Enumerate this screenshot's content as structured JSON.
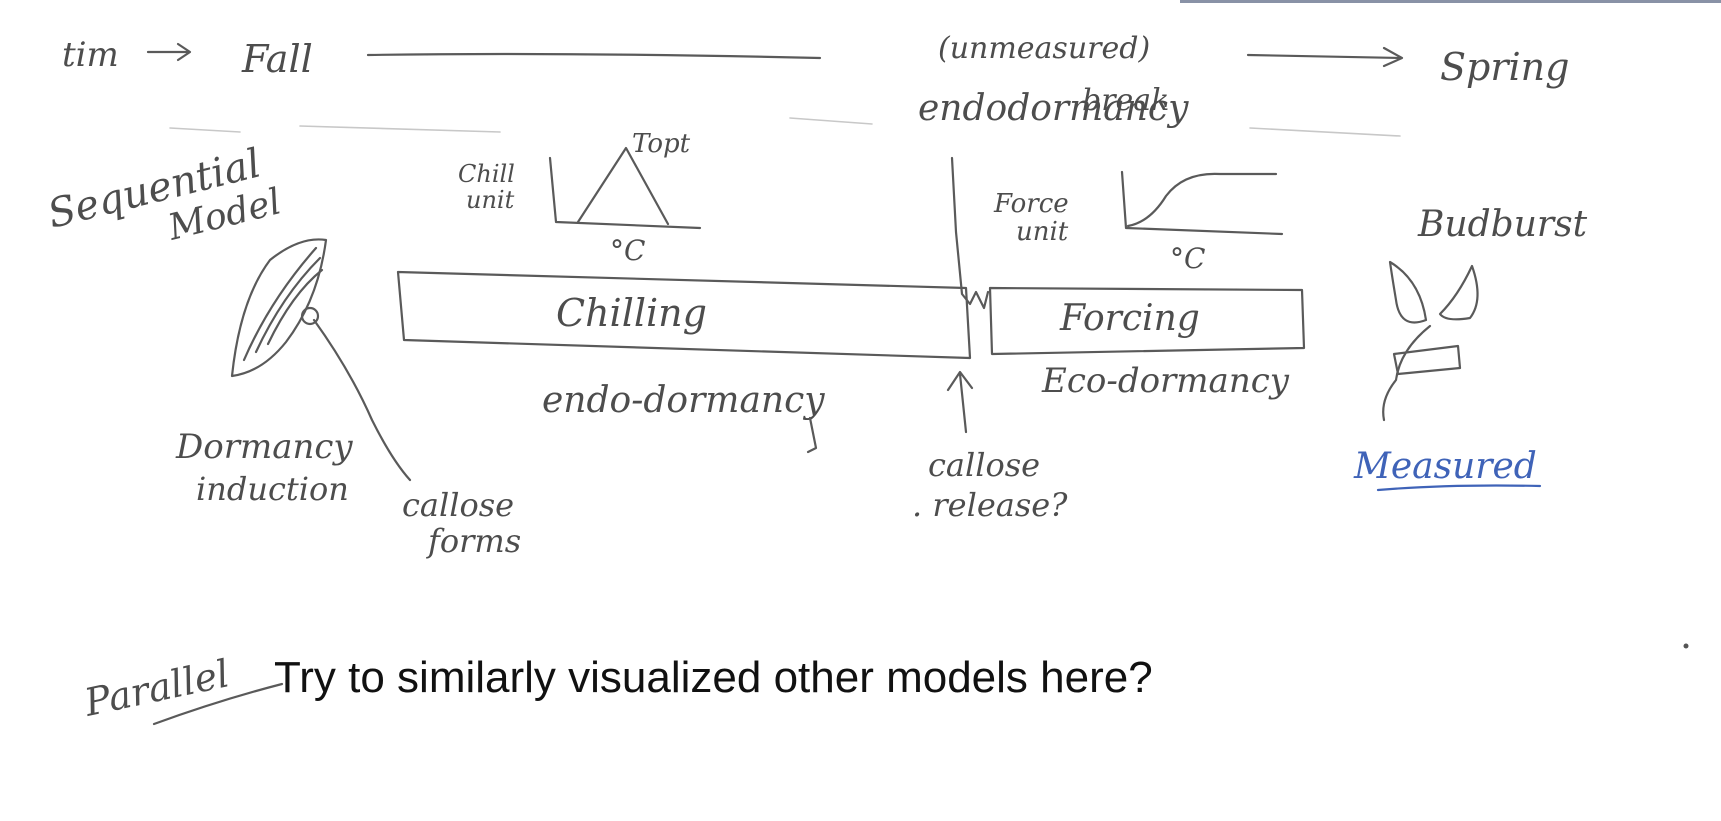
{
  "timeline": {
    "start_label": "tim",
    "fall_label": "Fall",
    "unmeasured_label": "(unmeasured)",
    "break_label_line1": "endodormancy",
    "break_label_line2": "break",
    "spring_label": "Spring"
  },
  "model": {
    "title_line1": "Sequential",
    "title_line2": "Model"
  },
  "chill_curve": {
    "unit_line1": "Chill",
    "unit_line2": "unit",
    "peak_label": "Topt",
    "axis_label": "°C"
  },
  "force_curve": {
    "unit_line1": "Force",
    "unit_line2": "unit",
    "axis_label": "°C"
  },
  "phases": {
    "chilling_label": "Chilling",
    "forcing_label": "Forcing",
    "endo_label": "endo-dormancy",
    "eco_label": "Eco-dormancy"
  },
  "annotations": {
    "induction_line1": "Dormancy",
    "induction_line2": "induction",
    "callose_forms_line1": "callose",
    "callose_forms_line2": "forms",
    "callose_release_line1": "callose",
    "callose_release_line2": ". release?",
    "budburst_label": "Budburst",
    "measured_label": "Measured"
  },
  "parallel": {
    "label": "Parallel",
    "note": "Try to similarly visualized other models here?"
  },
  "colors": {
    "pencil": "#4a4a4a",
    "measured_ink": "#3f63b8",
    "typed_text": "#111111"
  }
}
